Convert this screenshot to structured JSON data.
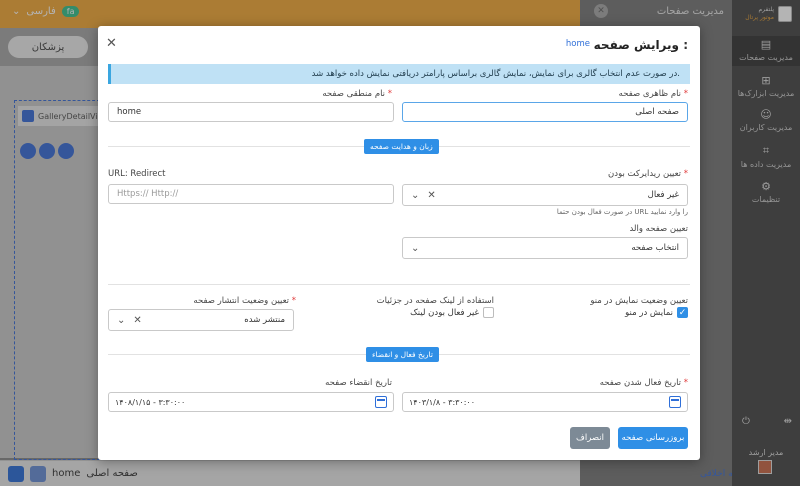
{
  "background": {
    "language_label": "فارسی",
    "language_badge": "fa",
    "doctors_button": "پزشکان",
    "gallery_chip": "GalleryDetailView",
    "bottom_page_label": "صفحه اصلی",
    "bottom_page_value": "home"
  },
  "page_panel": {
    "title": "مدیریت صفحات",
    "link_text": "کمیته اخلاقی"
  },
  "sidebar": {
    "logo_line1": "پلتفرم",
    "logo_line2": "موتور پرتال",
    "items": [
      {
        "label": "مدیریت صفحات",
        "icon": "page-icon"
      },
      {
        "label": "مدیریت ابزارک‌ها",
        "icon": "widgets-icon"
      },
      {
        "label": "مدیریت کاربران",
        "icon": "users-icon"
      },
      {
        "label": "مدیریت داده ها",
        "icon": "data-icon"
      },
      {
        "label": "تنظیمات",
        "icon": "gear-icon"
      }
    ],
    "user_name": "مدیر ارشد"
  },
  "modal": {
    "title": "ویرایش صفحه",
    "title_sep": ":",
    "title_page": "home",
    "info": "در صورت عدم انتخاب گالری برای نمایش، نمایش گالری براساس پارامتر دریافتی نمایش داده خواهد شد.",
    "display_name_label": "نام ظاهری صفحه",
    "display_name_value": "صفحه اصلی",
    "logical_name_label": "نام منطقی صفحه",
    "logical_name_value": "home",
    "section_language": "زبان و هدایت صفحه",
    "redirect_label": "تعیین ریدایرکت بودن",
    "redirect_value": "غیر فعال",
    "redirect_hint": "در صورت فعال بودن حتما URL را وارد نمایید",
    "url_label": "URL: Redirect",
    "url_placeholder": "Https:// Http://",
    "parent_label": "تعیین صفحه والد",
    "parent_value": "انتخاب صفحه",
    "menu_status_label": "تعیین وضعیت نمایش در منو",
    "menu_status_checkbox": "نمایش در منو",
    "menu_status_checked": true,
    "link_usage_label": "استفاده از لینک صفحه در جزئیات",
    "link_usage_checkbox": "غیر فعال بودن لینک",
    "link_usage_checked": false,
    "publish_label": "تعیین وضعیت انتشار صفحه",
    "publish_value": "منتشر شده",
    "section_dates": "تاریخ فعال و انقضاء",
    "activate_label": "تاریخ فعال شدن صفحه",
    "activate_value": "۱۴۰۳/۱/۸ - ۳:۳۰:۰۰",
    "expire_label": "تاریخ انقضاء صفحه",
    "expire_value": "۱۴۰۸/۱/۱۵ - ۳:۳۰:۰۰",
    "update_button": "بروزرسانی صفحه",
    "cancel_button": "انصراف"
  }
}
